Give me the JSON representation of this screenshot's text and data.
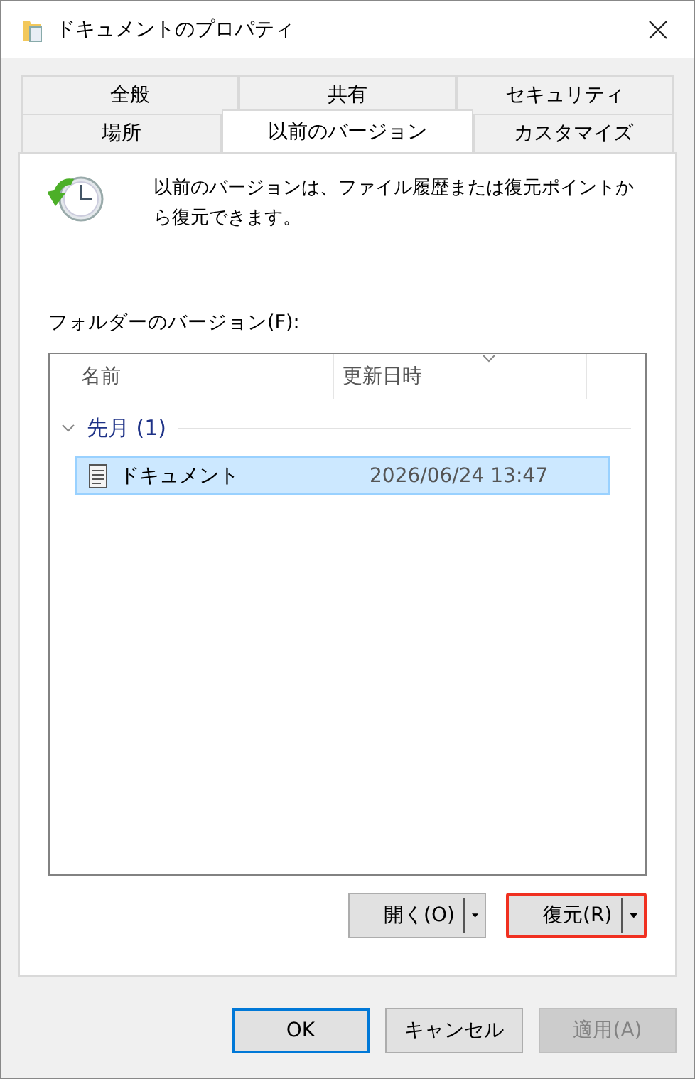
{
  "window": {
    "title": "ドキュメントのプロパティ"
  },
  "tab_rows": [
    {
      "tabs": [
        {
          "label": "全般",
          "selected": false
        },
        {
          "label": "共有",
          "selected": false
        },
        {
          "label": "セキュリティ",
          "selected": false
        }
      ]
    },
    {
      "tabs": [
        {
          "label": "場所",
          "selected": false
        },
        {
          "label": "以前のバージョン",
          "selected": true
        },
        {
          "label": "カスタマイズ",
          "selected": false
        }
      ]
    }
  ],
  "intro": "以前のバージョンは、ファイル履歴または復元ポイントから復元できます。",
  "list_label": "フォルダーのバージョン(F):",
  "columns": [
    "名前",
    "更新日時"
  ],
  "groups": [
    {
      "label": "先月 (1)",
      "expanded": true,
      "items": [
        {
          "name": "ドキュメント",
          "modified": "2026/06/24 13:47",
          "selected": true
        }
      ]
    }
  ],
  "actions": [
    {
      "label": "開く(O)",
      "highlighted": false
    },
    {
      "label": "復元(R)",
      "highlighted": true
    }
  ],
  "buttons": [
    {
      "label": "OK",
      "default": true,
      "disabled": false
    },
    {
      "label": "キャンセル",
      "default": false,
      "disabled": false
    },
    {
      "label": "適用(A)",
      "default": false,
      "disabled": true
    }
  ]
}
